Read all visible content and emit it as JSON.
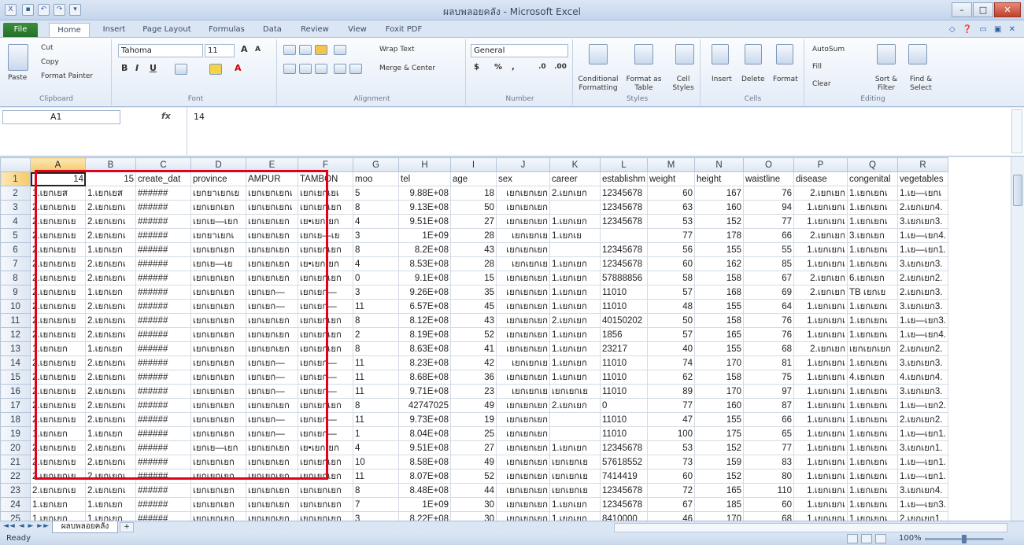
{
  "window": {
    "title": "ผลบพลอยคลัง - Microsoft Excel",
    "minimize": "–",
    "maximize": "□",
    "close": "✕"
  },
  "tabs": [
    "File",
    "Home",
    "Insert",
    "Page Layout",
    "Formulas",
    "Data",
    "Review",
    "View",
    "Foxit PDF"
  ],
  "ribbon": {
    "clipboard": {
      "paste": "Paste",
      "cut": "Cut",
      "copy": "Copy",
      "format_painter": "Format Painter",
      "label": "Clipboard"
    },
    "font": {
      "name": "Tahoma",
      "size": "11",
      "label": "Font"
    },
    "alignment": {
      "wrap": "Wrap Text",
      "merge": "Merge & Center",
      "label": "Alignment"
    },
    "number": {
      "format": "General",
      "label": "Number"
    },
    "styles": {
      "conditional": "Conditional Formatting",
      "format_table": "Format as Table",
      "cell_styles": "Cell Styles",
      "label": "Styles"
    },
    "cells": {
      "insert": "Insert",
      "delete": "Delete",
      "format": "Format",
      "label": "Cells"
    },
    "editing": {
      "autosum": "AutoSum",
      "fill": "Fill",
      "clear": "Clear",
      "sort": "Sort & Filter",
      "find": "Find & Select",
      "label": "Editing"
    }
  },
  "formula_bar": {
    "name_box": "A1",
    "fx": "fx",
    "value": "14"
  },
  "columns": [
    "A",
    "B",
    "C",
    "D",
    "E",
    "F",
    "G",
    "H",
    "I",
    "J",
    "K",
    "L",
    "M",
    "N",
    "O",
    "P",
    "Q",
    "R"
  ],
  "rows": [
    [
      "1",
      "14",
      "15",
      "create_dat",
      "province",
      "AMPUR",
      "TAMBON",
      "moo",
      "tel",
      "age",
      "sex",
      "career",
      "establishm",
      "weight",
      "height",
      "waistline",
      "disease",
      "congenital",
      "vegetables"
    ],
    [
      "2",
      "1.เยกเยส",
      "1.เยกเยส",
      "######",
      "เยกยาเยกเย",
      "เยกเยกเยกเ",
      "เยกเยกเยเ",
      "5",
      "9.88E+08",
      "18",
      "เยกเยกเยก",
      "2.เยกเยก",
      "12345678",
      "60",
      "167",
      "76",
      "2.เยกเยก",
      "1.เยกเยกเ",
      "1.เย—เยกเ"
    ],
    [
      "3",
      "2.เยกเยกเย",
      "2.เยกเยกเ",
      "######",
      "เยกเยกเยก",
      "เยกเยกเยกเ",
      "เยกเยกเยก",
      "8",
      "9.13E+08",
      "50",
      "เยกเยกเยก",
      "",
      "12345678",
      "63",
      "160",
      "94",
      "1.เยกเยกเ",
      "1.เยกเยกเ",
      "2.เยกเยก4."
    ],
    [
      "4",
      "2.เยกเยกเย",
      "2.เยกเยกเ",
      "######",
      "เยกเย—เยก",
      "เยกเยกเยก",
      "เย•เยกเยก",
      "4",
      "9.51E+08",
      "27",
      "เยกเยกเยก",
      "1.เยกเยก",
      "12345678",
      "53",
      "152",
      "77",
      "1.เยกเยกเ",
      "1.เยกเยกเ",
      "3.เยกเยก3."
    ],
    [
      "5",
      "2.เยกเยกเย",
      "2.เยกเยกเ",
      "######",
      "เยกยาเยกเ",
      "เยกเยกเยก",
      "เยกเย—เย",
      "3",
      "1E+09",
      "28",
      "เยกเยกเย",
      "1.เยกเย",
      "",
      "77",
      "178",
      "66",
      "2.เยกเยก",
      "3.เยกเยก",
      "1.เย—เยก4."
    ],
    [
      "6",
      "2.เยกเยกเย",
      "1.เยกเยก",
      "######",
      "เยกเยกเยก",
      "เยกเยกเยก",
      "เยกเยกเยก",
      "8",
      "8.2E+08",
      "43",
      "เยกเยกเยก",
      "",
      "12345678",
      "56",
      "155",
      "55",
      "1.เยกเยกเ",
      "1.เยกเยกเ",
      "1.เย—เยก1."
    ],
    [
      "7",
      "2.เยกเยกเย",
      "2.เยกเยกเ",
      "######",
      "เยกเย—เย",
      "เยกเยกเยก",
      "เย•เยกเยก",
      "4",
      "8.53E+08",
      "28",
      "เยกเยกเย",
      "1.เยกเยก",
      "12345678",
      "60",
      "162",
      "85",
      "1.เยกเยกเ",
      "1.เยกเยกเ",
      "3.เยกเยก3."
    ],
    [
      "8",
      "2.เยกเยกเย",
      "2.เยกเยกเ",
      "######",
      "เยกเยกเยก",
      "เยกเยกเยก",
      "เยกเยกเยก",
      "0",
      "9.1E+08",
      "15",
      "เยกเยกเยก",
      "1.เยกเยก",
      "57888856",
      "58",
      "158",
      "67",
      "2.เยกเยก",
      "6.เยกเยก",
      "2.เยกเยก2."
    ],
    [
      "9",
      "2.เยกเยกเย",
      "1.เยกเยก",
      "######",
      "เยกเยกเยก",
      "เยกเยก—",
      "เยกเยก—",
      "3",
      "9.26E+08",
      "35",
      "เยกเยกเยก",
      "1.เยกเยก",
      "11010",
      "57",
      "168",
      "69",
      "2.เยกเยก",
      "TB เยกเย",
      "2.เยกเยก3."
    ],
    [
      "10",
      "2.เยกเยกเย",
      "2.เยกเยกเ",
      "######",
      "เยกเยกเยก",
      "เยกเยก—",
      "เยกเยก—",
      "11",
      "6.57E+08",
      "45",
      "เยกเยกเยก",
      "1.เยกเยก",
      "11010",
      "48",
      "155",
      "64",
      "1.เยกเยกเ",
      "1.เยกเยกเ",
      "3.เยกเยก3."
    ],
    [
      "11",
      "2.เยกเยกเย",
      "2.เยกเยกเ",
      "######",
      "เยกเยกเยก",
      "เยกเยกเยก",
      "เยกเยกเยก",
      "8",
      "8.12E+08",
      "43",
      "เยกเยกเยก",
      "2.เยกเยก",
      "40150202",
      "50",
      "158",
      "76",
      "1.เยกเยกเ",
      "1.เยกเยกเ",
      "1.เย—เยก3."
    ],
    [
      "12",
      "2.เยกเยกเย",
      "2.เยกเยกเ",
      "######",
      "เยกเยกเยก",
      "เยกเยกเยก",
      "เยกเยกเยก",
      "2",
      "8.19E+08",
      "52",
      "เยกเยกเยก",
      "1.เยกเยก",
      "1856",
      "57",
      "165",
      "76",
      "1.เยกเยกเ",
      "1.เยกเยกเ",
      "1.เย—เยก4."
    ],
    [
      "13",
      "1.เยกเยก",
      "1.เยกเยก",
      "######",
      "เยกเยกเยก",
      "เยกเยกเยก",
      "เยกเยกเยก",
      "8",
      "8.63E+08",
      "41",
      "เยกเยกเยก",
      "1.เยกเยก",
      "23217",
      "40",
      "155",
      "68",
      "2.เยกเยก",
      "เยกเยกเยก",
      "2.เยกเยก2."
    ],
    [
      "14",
      "2.เยกเยกเย",
      "2.เยกเยกเ",
      "######",
      "เยกเยกเยก",
      "เยกเยก—",
      "เยกเยก—",
      "11",
      "8.23E+08",
      "42",
      "เยกเยกเย",
      "1.เยกเยก",
      "11010",
      "74",
      "170",
      "81",
      "1.เยกเยกเ",
      "1.เยกเยกเ",
      "3.เยกเยก3."
    ],
    [
      "15",
      "2.เยกเยกเย",
      "2.เยกเยกเ",
      "######",
      "เยกเยกเยก",
      "เยกเยก—",
      "เยกเยก—",
      "11",
      "8.68E+08",
      "36",
      "เยกเยกเยก",
      "1.เยกเยก",
      "11010",
      "62",
      "158",
      "75",
      "1.เยกเยกเ",
      "4.เยกเยก",
      "4.เยกเยก4."
    ],
    [
      "16",
      "2.เยกเยกเย",
      "2.เยกเยกเ",
      "######",
      "เยกเยกเยก",
      "เยกเยก—",
      "เยกเยก—",
      "11",
      "9.71E+08",
      "23",
      "เยกเยกเย",
      "เยกเยกเย",
      "11010",
      "89",
      "170",
      "97",
      "1.เยกเยกเ",
      "1.เยกเยกเ",
      "3.เยกเยก3."
    ],
    [
      "17",
      "2.เยกเยกเย",
      "2.เยกเยกเ",
      "######",
      "เยกเยกเยก",
      "เยกเยกเยก",
      "เยกเยกเยก",
      "8",
      "42747025",
      "49",
      "เยกเยกเยก",
      "2.เยกเยก",
      "0",
      "77",
      "160",
      "87",
      "1.เยกเยกเ",
      "1.เยกเยกเ",
      "1.เย—เยก2."
    ],
    [
      "18",
      "2.เยกเยกเย",
      "2.เยกเยกเ",
      "######",
      "เยกเยกเยก",
      "เยกเยก—",
      "เยกเยก—",
      "11",
      "9.73E+08",
      "19",
      "เยกเยกเยก",
      "",
      "11010",
      "47",
      "155",
      "66",
      "1.เยกเยกเ",
      "1.เยกเยกเ",
      "2.เยกเยก2."
    ],
    [
      "19",
      "1.เยกเยก",
      "1.เยกเยก",
      "######",
      "เยกเยกเยก",
      "เยกเยก—",
      "เยกเยก—",
      "1",
      "8.04E+08",
      "25",
      "เยกเยกเยก",
      "",
      "11010",
      "100",
      "175",
      "65",
      "1.เยกเยกเ",
      "1.เยกเยกเ",
      "1.เย—เยก1."
    ],
    [
      "20",
      "2.เยกเยกเย",
      "2.เยกเยกเ",
      "######",
      "เยกเย—เยก",
      "เยกเยกเยก",
      "เย•เยกเยก",
      "4",
      "9.51E+08",
      "27",
      "เยกเยกเยก",
      "1.เยกเยก",
      "12345678",
      "53",
      "152",
      "77",
      "1.เยกเยกเ",
      "1.เยกเยกเ",
      "3.เยกเยก1."
    ],
    [
      "21",
      "2.เยกเยกเย",
      "2.เยกเยกเ",
      "######",
      "เยกเยกเยก",
      "เยกเยกเยก",
      "เยกเยกเยก",
      "10",
      "8.58E+08",
      "49",
      "เยกเยกเยก",
      "เยกเยกเย",
      "57618552",
      "73",
      "159",
      "83",
      "1.เยกเยกเ",
      "1.เยกเยกเ",
      "1.เย—เยก1."
    ],
    [
      "22",
      "2.เยกเยกเย",
      "2.เยกเยกเ",
      "######",
      "เยกเยกเยก",
      "เยกเยกเยก",
      "เยกเยกเยก",
      "11",
      "8.07E+08",
      "52",
      "เยกเยกเยก",
      "เยกเยกเย",
      "7414419",
      "60",
      "152",
      "80",
      "1.เยกเยกเ",
      "1.เยกเยกเ",
      "1.เย—เยก1."
    ],
    [
      "23",
      "2.เยกเยกเย",
      "2.เยกเยกเ",
      "######",
      "เยกเยกเยก",
      "เยกเยกเยก",
      "เยกเยกเยก",
      "8",
      "8.48E+08",
      "44",
      "เยกเยกเยก",
      "เยกเยกเย",
      "12345678",
      "72",
      "165",
      "110",
      "1.เยกเยกเ",
      "1.เยกเยกเ",
      "3.เยกเยก4."
    ],
    [
      "24",
      "1.เยกเยก",
      "1.เยกเยก",
      "######",
      "เยกเยกเยก",
      "เยกเยกเยก",
      "เยกเยกเยก",
      "7",
      "1E+09",
      "30",
      "เยกเยกเยก",
      "1.เยกเยก",
      "12345678",
      "67",
      "185",
      "60",
      "1.เยกเยกเ",
      "1.เยกเยกเ",
      "1.เย—เยก3."
    ],
    [
      "25",
      "1.เยกเยก",
      "1.เยกเยก",
      "######",
      "เยกเยกเยก",
      "เยกเยกเยก",
      "เยกเยกเยก",
      "3",
      "8.22E+08",
      "30",
      "เยกเยกเยก",
      "1.เยกเยก",
      "8410000",
      "46",
      "170",
      "68",
      "1.เยกเยกเ",
      "1.เยกเยกเ",
      "2.เยกเยก1."
    ]
  ],
  "sheet": {
    "name": "ผลบพลอยคลัง",
    "nav": "◄◄ ◄ ► ►►"
  },
  "status": {
    "ready": "Ready",
    "zoom": "100%"
  }
}
